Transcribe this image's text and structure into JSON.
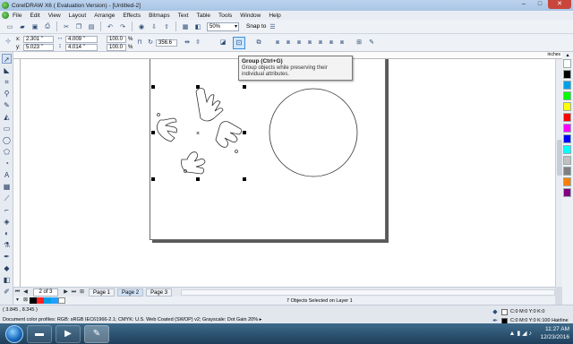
{
  "title_bar": {
    "title": "CorelDRAW X6 ( Evaluation Version) - [Untitled-2]",
    "min": "–",
    "max": "□",
    "close": "✕"
  },
  "menu": [
    "File",
    "Edit",
    "View",
    "Layout",
    "Arrange",
    "Effects",
    "Bitmaps",
    "Text",
    "Table",
    "Tools",
    "Window",
    "Help"
  ],
  "standard_toolbar": {
    "zoom_value": "50%",
    "snap_label": "Snap to"
  },
  "property_bar": {
    "x_label": "x:",
    "x_value": "2.301 \"",
    "y_label": "y:",
    "y_value": "5.023 \"",
    "w_value": "4.009 \"",
    "h_value": "4.014 \"",
    "scale_x": "100.0",
    "scale_y": "100.0",
    "percent": "%",
    "rotation": "356.6"
  },
  "tooltip": {
    "title": "Group (Ctrl+G)",
    "description": "Group objects while preserving their individual attributes."
  },
  "ruler": {
    "unit": "inches"
  },
  "page_nav": {
    "counter": "2 of 3",
    "tabs": [
      "Page 1",
      "Page 2",
      "Page 3"
    ],
    "active_tab": "Page 2"
  },
  "document_status": "7 Objects Selected on Layer 1",
  "status_bar": {
    "coordinates": "( 3.845 , 8.345 )",
    "profiles": "Document color profiles: RGB: sRGB IEC61966-2.1; CMYK: U.S. Web Coated (SWOP) v2; Grayscale: Dot Gain 20% ▸",
    "fill": "C:0 M:0 Y:0 K:0",
    "outline": "C:0 M:0 Y:0 K:100  Hairline"
  },
  "taskbar": {
    "time": "11:27 AM",
    "date": "12/23/2016"
  },
  "palette_colors": [
    "#ffffff",
    "#000000",
    "#00a0e9",
    "#00ff00",
    "#ffff00",
    "#ff0000",
    "#ff00ff",
    "#0000ff",
    "#00ffff",
    "#c0c0c0",
    "#808080",
    "#ff8000",
    "#800080"
  ],
  "strip_colors": [
    "#000000",
    "#ff2020",
    "#00a0e9",
    "#1fa0ff",
    "#ffffff"
  ]
}
